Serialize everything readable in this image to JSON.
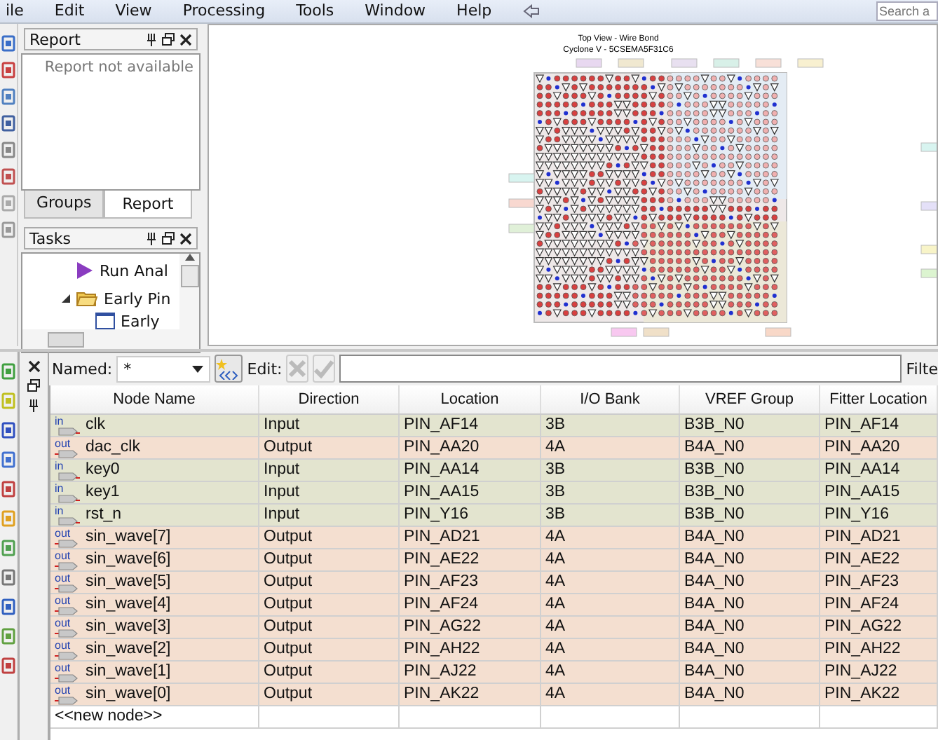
{
  "menu": [
    "ile",
    "Edit",
    "View",
    "Processing",
    "Tools",
    "Window",
    "Help"
  ],
  "search": {
    "placeholder": "Search a"
  },
  "report_panel": {
    "title": "Report",
    "message": "Report not available",
    "tabs": [
      {
        "label": "Groups",
        "selected": false
      },
      {
        "label": "Report",
        "selected": true
      }
    ]
  },
  "tasks_panel": {
    "title": "Tasks",
    "items": [
      {
        "label": "Run Anal",
        "kind": "run"
      },
      {
        "label": "Early Pin",
        "kind": "folder",
        "expanded": true,
        "children": [
          {
            "label": "Early",
            "kind": "file"
          }
        ]
      }
    ]
  },
  "chip_view": {
    "title": "Top View - Wire Bond",
    "subtitle": "Cyclone V - 5CSEMA5F31C6"
  },
  "filter_bar": {
    "named_label": "Named:",
    "named_value": "*",
    "edit_label": "Edit:",
    "filter_label": "Filte"
  },
  "table": {
    "columns": [
      "Node Name",
      "Direction",
      "Location",
      "I/O Bank",
      "VREF Group",
      "Fitter Location"
    ],
    "rows": [
      {
        "kind": "in",
        "tag": "in",
        "cells": [
          "clk",
          "Input",
          "PIN_AF14",
          "3B",
          "B3B_N0",
          "PIN_AF14"
        ]
      },
      {
        "kind": "out",
        "tag": "out",
        "cells": [
          "dac_clk",
          "Output",
          "PIN_AA20",
          "4A",
          "B4A_N0",
          "PIN_AA20"
        ]
      },
      {
        "kind": "in",
        "tag": "in",
        "cells": [
          "key0",
          "Input",
          "PIN_AA14",
          "3B",
          "B3B_N0",
          "PIN_AA14"
        ]
      },
      {
        "kind": "in",
        "tag": "in",
        "cells": [
          "key1",
          "Input",
          "PIN_AA15",
          "3B",
          "B3B_N0",
          "PIN_AA15"
        ]
      },
      {
        "kind": "in",
        "tag": "in",
        "cells": [
          "rst_n",
          "Input",
          "PIN_Y16",
          "3B",
          "B3B_N0",
          "PIN_Y16"
        ]
      },
      {
        "kind": "out",
        "tag": "out",
        "cells": [
          "sin_wave[7]",
          "Output",
          "PIN_AD21",
          "4A",
          "B4A_N0",
          "PIN_AD21"
        ]
      },
      {
        "kind": "out",
        "tag": "out",
        "cells": [
          "sin_wave[6]",
          "Output",
          "PIN_AE22",
          "4A",
          "B4A_N0",
          "PIN_AE22"
        ]
      },
      {
        "kind": "out",
        "tag": "out",
        "cells": [
          "sin_wave[5]",
          "Output",
          "PIN_AF23",
          "4A",
          "B4A_N0",
          "PIN_AF23"
        ]
      },
      {
        "kind": "out",
        "tag": "out",
        "cells": [
          "sin_wave[4]",
          "Output",
          "PIN_AF24",
          "4A",
          "B4A_N0",
          "PIN_AF24"
        ]
      },
      {
        "kind": "out",
        "tag": "out",
        "cells": [
          "sin_wave[3]",
          "Output",
          "PIN_AG22",
          "4A",
          "B4A_N0",
          "PIN_AG22"
        ]
      },
      {
        "kind": "out",
        "tag": "out",
        "cells": [
          "sin_wave[2]",
          "Output",
          "PIN_AH22",
          "4A",
          "B4A_N0",
          "PIN_AH22"
        ]
      },
      {
        "kind": "out",
        "tag": "out",
        "cells": [
          "sin_wave[1]",
          "Output",
          "PIN_AJ22",
          "4A",
          "B4A_N0",
          "PIN_AJ22"
        ]
      },
      {
        "kind": "out",
        "tag": "out",
        "cells": [
          "sin_wave[0]",
          "Output",
          "PIN_AK22",
          "4A",
          "B4A_N0",
          "PIN_AK22"
        ]
      }
    ],
    "new_row": "<<new node>>"
  }
}
